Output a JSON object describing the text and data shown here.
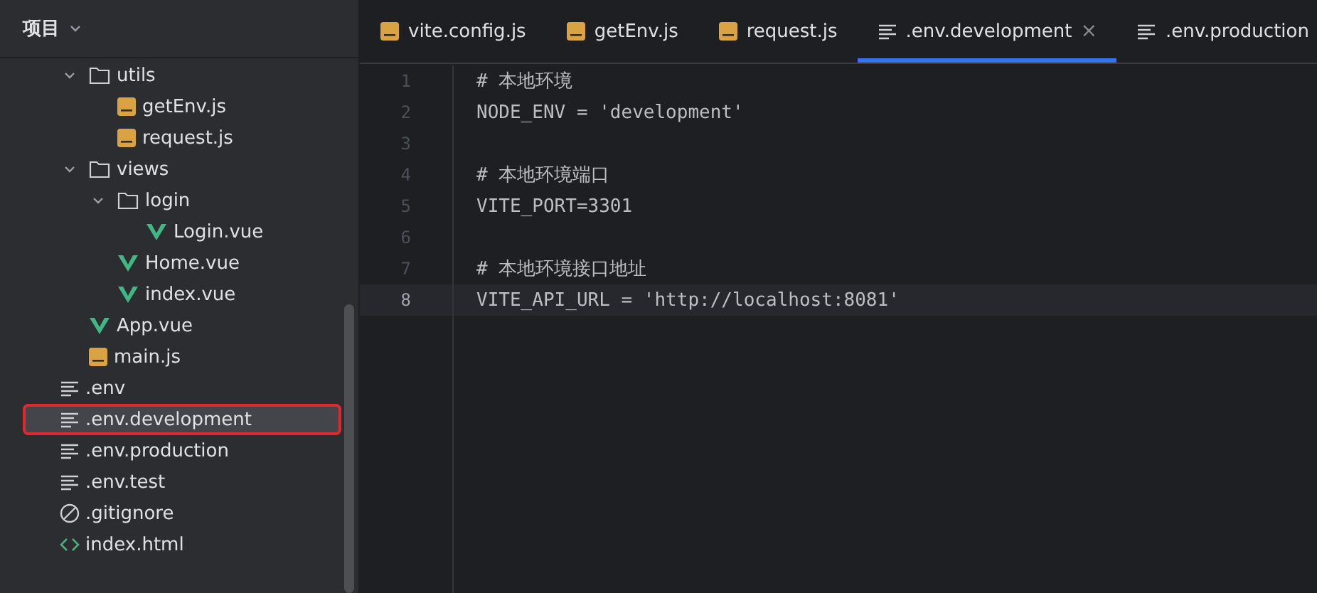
{
  "sidebar": {
    "title": "项目",
    "tree": [
      {
        "children": [
          {
            "kind": "folder",
            "name": "utils",
            "expanded": true,
            "selected": false,
            "children": [
              {
                "kind": "js",
                "name": "getEnv.js",
                "selected": false
              },
              {
                "kind": "js",
                "name": "request.js",
                "selected": false
              }
            ]
          },
          {
            "kind": "folder",
            "name": "views",
            "expanded": true,
            "selected": false,
            "children": [
              {
                "kind": "folder",
                "name": "login",
                "expanded": true,
                "selected": false,
                "children": [
                  {
                    "kind": "vue",
                    "name": "Login.vue",
                    "selected": false
                  }
                ]
              },
              {
                "kind": "vue",
                "name": "Home.vue",
                "selected": false
              },
              {
                "kind": "vue",
                "name": "index.vue",
                "selected": false
              }
            ]
          },
          {
            "kind": "vue",
            "name": "App.vue",
            "selected": false
          },
          {
            "kind": "js",
            "name": "main.js",
            "selected": false
          }
        ]
      },
      {
        "kind": "text",
        "name": ".env",
        "selected": false
      },
      {
        "kind": "text",
        "name": ".env.development",
        "selected": true,
        "outlined": true
      },
      {
        "kind": "text",
        "name": ".env.production",
        "selected": false
      },
      {
        "kind": "text",
        "name": ".env.test",
        "selected": false
      },
      {
        "kind": "ignore",
        "name": ".gitignore",
        "selected": false
      },
      {
        "kind": "html",
        "name": "index.html",
        "selected": false
      }
    ]
  },
  "tabs": [
    {
      "kind": "js",
      "label": "vite.config.js",
      "selected": false
    },
    {
      "kind": "js",
      "label": "getEnv.js",
      "selected": false
    },
    {
      "kind": "js",
      "label": "request.js",
      "selected": false
    },
    {
      "kind": "text",
      "label": ".env.development",
      "selected": true,
      "close": "×"
    },
    {
      "kind": "text",
      "label": ".env.production",
      "selected": false
    }
  ],
  "editor": {
    "lines": [
      {
        "number": "1",
        "text": "# 本地环境",
        "current": false
      },
      {
        "number": "2",
        "text": "NODE_ENV = 'development'",
        "current": false
      },
      {
        "number": "3",
        "current": false
      },
      {
        "number": "4",
        "text": "# 本地环境端口",
        "current": false
      },
      {
        "number": "5",
        "text": "VITE_PORT=3301",
        "current": false
      },
      {
        "number": "6",
        "current": false
      },
      {
        "number": "7",
        "text": "# 本地环境接口地址",
        "current": false
      },
      {
        "number": "8",
        "text": "VITE_API_URL = 'http://localhost:8081'",
        "current": true
      }
    ]
  }
}
